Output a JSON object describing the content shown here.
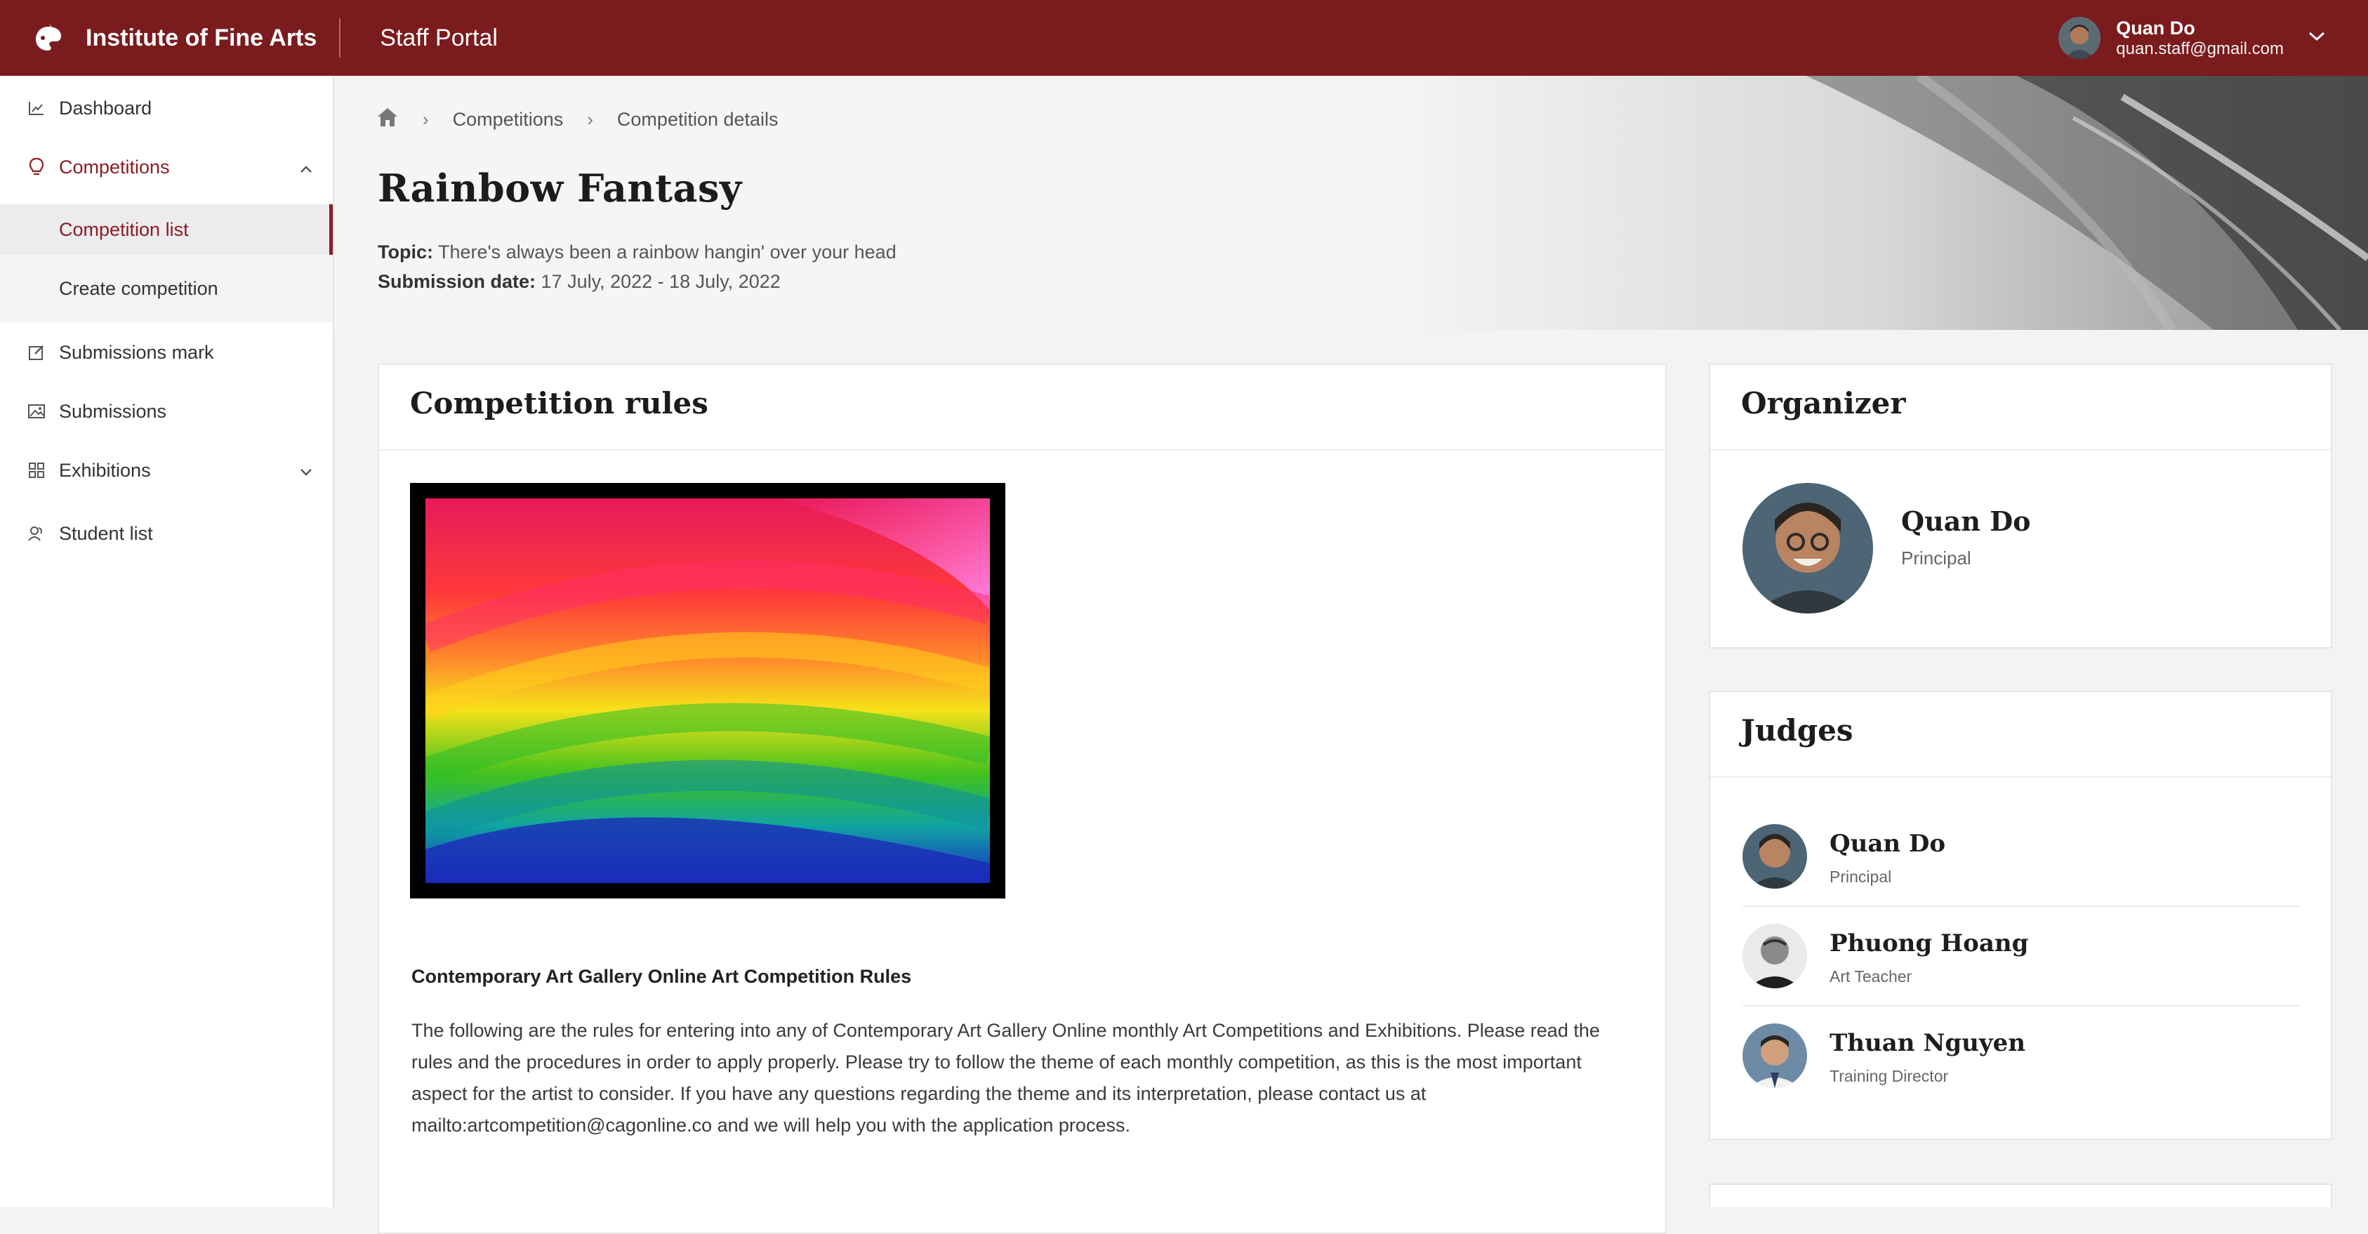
{
  "app": {
    "brand": "Institute of Fine Arts",
    "portal": "Staff Portal"
  },
  "user": {
    "name": "Quan Do",
    "email": "quan.staff@gmail.com"
  },
  "sidebar": {
    "dashboard": "Dashboard",
    "competitions": "Competitions",
    "competition_list": "Competition list",
    "create_competition": "Create competition",
    "submissions_mark": "Submissions mark",
    "submissions": "Submissions",
    "exhibitions": "Exhibitions",
    "student_list": "Student list"
  },
  "breadcrumb": {
    "level1": "Competitions",
    "level2": "Competition details"
  },
  "competition": {
    "title": "Rainbow Fantasy",
    "topic_label": "Topic:",
    "topic": "There's always been a rainbow hangin' over your head",
    "date_label": "Submission date:",
    "dates": "17 July, 2022 - 18 July, 2022"
  },
  "rules": {
    "title": "Competition rules",
    "heading": "Contemporary Art Gallery Online Art Competition Rules",
    "body": "The following are the rules for entering into any of Contemporary Art Gallery Online monthly Art Competitions and Exhibitions. Please read the rules and the procedures in order to apply properly. Please try to follow the theme of each monthly competition, as this is the most important aspect for the artist to consider. If you have any questions regarding the theme and its interpretation, please contact us at mailto:artcompetition@cagonline.co and we will help you with the application process."
  },
  "organizer": {
    "title": "Organizer",
    "name": "Quan Do",
    "role": "Principal"
  },
  "judges": {
    "title": "Judges",
    "items": [
      {
        "name": "Quan Do",
        "role": "Principal"
      },
      {
        "name": "Phuong Hoang",
        "role": "Art Teacher"
      },
      {
        "name": "Thuan Nguyen",
        "role": "Training Director"
      }
    ]
  },
  "colors": {
    "brand": "#7a1b1e",
    "accent": "#8a1d22"
  }
}
